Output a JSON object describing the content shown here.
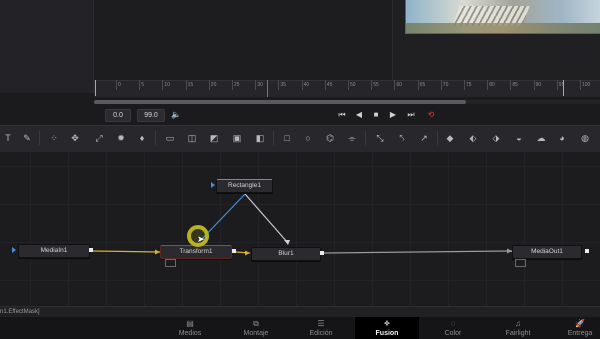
{
  "transport": {
    "start_field": "0.0",
    "end_field": "99.0",
    "ruler_labels": [
      "0",
      "5",
      "10",
      "15",
      "20",
      "25",
      "30",
      "35",
      "40",
      "45",
      "50",
      "55",
      "60",
      "65",
      "70",
      "75",
      "80",
      "85",
      "90",
      "95",
      "100",
      "105"
    ]
  },
  "nodes": {
    "media_in": "MediaIn1",
    "transform": "Transform1",
    "rectangle": "Rectangle1",
    "blur": "Blur1",
    "media_out": "MediaOut1"
  },
  "status": {
    "text": "n1.EffectMask]"
  },
  "page_tabs": [
    {
      "label": "Medios",
      "icon": "media-icon"
    },
    {
      "label": "Montaje",
      "icon": "cut-icon"
    },
    {
      "label": "Edición",
      "icon": "edit-icon"
    },
    {
      "label": "Fusion",
      "icon": "fusion-icon"
    },
    {
      "label": "Color",
      "icon": "color-icon"
    },
    {
      "label": "Fairlight",
      "icon": "fairlight-icon"
    },
    {
      "label": "Entrega",
      "icon": "deliver-icon"
    }
  ],
  "active_tab": "Fusion",
  "colors": {
    "accent_yellow": "#d6a92a",
    "playhead": "#e04a3a",
    "mask_link": "#3f8fe0",
    "cursor_highlight": "#b7b21e"
  }
}
